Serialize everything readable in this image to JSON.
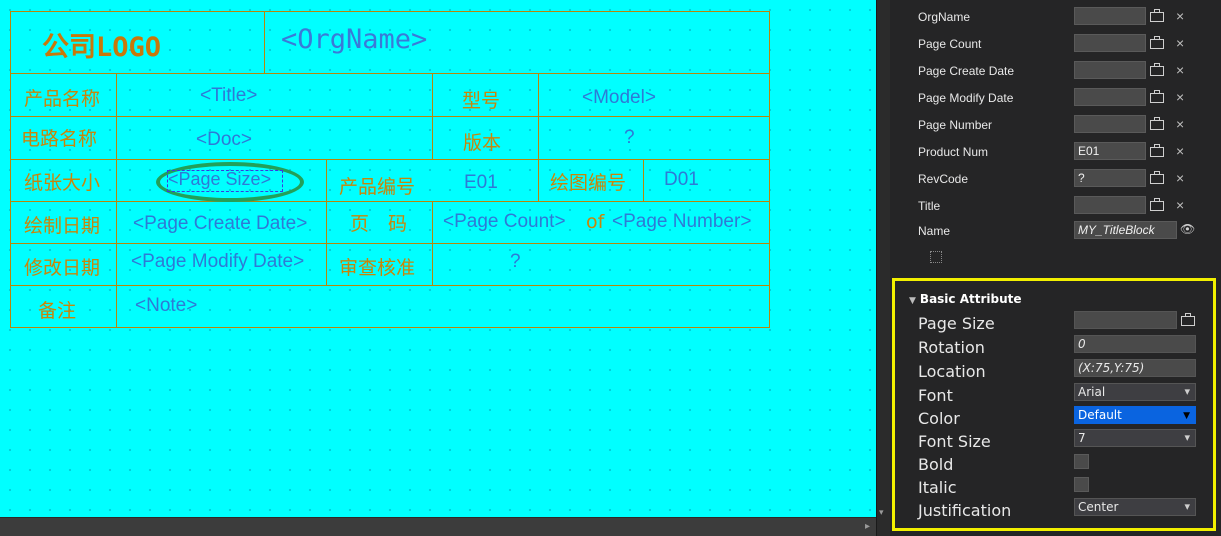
{
  "title_block": {
    "logo": "公司LOGO",
    "org_name": "<OrgName>",
    "product_name_label": "产品名称",
    "title_placeholder": "<Title>",
    "model_label": "型号",
    "model_placeholder": "<Model>",
    "circuit_name_label": "电路名称",
    "doc_placeholder": "<Doc>",
    "version_label": "版本",
    "version_value": "?",
    "paper_size_label": "纸张大小",
    "page_size_placeholder": "<Page Size>",
    "product_number_label": "产品编号",
    "product_number_value": "E01",
    "drawing_number_label": "绘图编号",
    "drawing_number_value": "D01",
    "draw_date_label": "绘制日期",
    "page_create_date_placeholder": "<Page Create Date>",
    "page_label": "页　码",
    "page_count_placeholder": "<Page Count>",
    "of_text": "of",
    "page_number_placeholder": "<Page Number>",
    "modify_date_label": "修改日期",
    "page_modify_date_placeholder": "<Page Modify Date>",
    "review_label": "审查核准",
    "review_value": "?",
    "note_label": "备注",
    "note_placeholder": "<Note>"
  },
  "properties": [
    {
      "label": "OrgName",
      "value": ""
    },
    {
      "label": "Page Count",
      "value": ""
    },
    {
      "label": "Page Create Date",
      "value": ""
    },
    {
      "label": "Page Modify Date",
      "value": ""
    },
    {
      "label": "Page Number",
      "value": ""
    },
    {
      "label": "Product Num",
      "value": "E01"
    },
    {
      "label": "RevCode",
      "value": "?"
    },
    {
      "label": "Title",
      "value": ""
    }
  ],
  "name_row": {
    "label": "Name",
    "value": "MY_TitleBlock"
  },
  "basic_attribute": {
    "title": "Basic Attribute",
    "page_size": {
      "label": "Page Size",
      "value": ""
    },
    "rotation": {
      "label": "Rotation",
      "value": "0"
    },
    "location": {
      "label": "Location",
      "value": "(X:75,Y:75)"
    },
    "font": {
      "label": "Font",
      "value": "Arial"
    },
    "color": {
      "label": "Color",
      "value": "Default"
    },
    "font_size": {
      "label": "Font Size",
      "value": "7"
    },
    "bold": {
      "label": "Bold",
      "checked": false
    },
    "italic": {
      "label": "Italic",
      "checked": false
    },
    "justification": {
      "label": "Justification",
      "value": "Center"
    }
  },
  "colors": {
    "canvas": "#00ffff",
    "grid_line": "#b8860b",
    "label_text": "#c8860a",
    "placeholder_text": "#2e7ad6",
    "highlight_ellipse": "#22a05a",
    "highlight_box": "#f2f000",
    "panel_bg": "#252526",
    "color_dropdown": "#0a64e0"
  }
}
